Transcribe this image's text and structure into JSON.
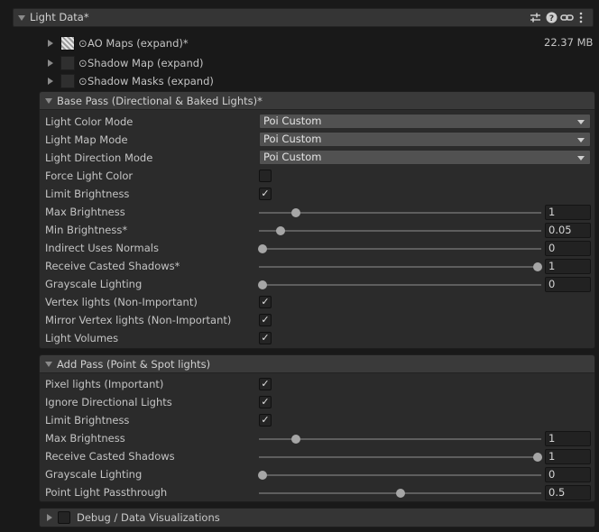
{
  "header": {
    "title": "Light Data*"
  },
  "textures": [
    {
      "label": "AO Maps (expand)*",
      "size": "22.37 MB",
      "has_preview": true
    },
    {
      "label": "Shadow Map (expand)",
      "size": "",
      "has_preview": false
    },
    {
      "label": "Shadow Masks (expand)",
      "size": "",
      "has_preview": false
    }
  ],
  "base_pass": {
    "title": "Base Pass (Directional & Baked Lights)*",
    "light_color_mode": {
      "label": "Light Color Mode",
      "value": "Poi Custom"
    },
    "light_map_mode": {
      "label": "Light Map Mode",
      "value": "Poi Custom"
    },
    "light_direction_mode": {
      "label": "Light Direction Mode",
      "value": "Poi Custom"
    },
    "force_light_color": {
      "label": "Force Light Color",
      "checked": false,
      "mark": ""
    },
    "limit_brightness": {
      "label": "Limit Brightness",
      "checked": true,
      "mark": "✓"
    },
    "max_brightness": {
      "label": "Max Brightness",
      "value": "1",
      "fraction": 0.12
    },
    "min_brightness": {
      "label": "Min Brightness*",
      "value": "0.05",
      "fraction": 0.065
    },
    "indirect_uses_normals": {
      "label": "Indirect Uses Normals",
      "value": "0",
      "fraction": 0
    },
    "receive_casted_shadows": {
      "label": "Receive Casted Shadows*",
      "value": "1",
      "fraction": 1
    },
    "grayscale_lighting": {
      "label": "Grayscale Lighting",
      "value": "0",
      "fraction": 0
    },
    "vertex_lights": {
      "label": "Vertex lights (Non-Important)",
      "checked": true,
      "mark": "✓"
    },
    "mirror_vertex_lights": {
      "label": "Mirror Vertex lights (Non-Important)",
      "checked": true,
      "mark": "✓"
    },
    "light_volumes": {
      "label": "Light Volumes",
      "checked": true,
      "mark": "✓"
    }
  },
  "add_pass": {
    "title": "Add Pass (Point & Spot lights)",
    "pixel_lights": {
      "label": "Pixel lights (Important)",
      "checked": true,
      "mark": "✓"
    },
    "ignore_directional": {
      "label": "Ignore Directional Lights",
      "checked": true,
      "mark": "✓"
    },
    "limit_brightness": {
      "label": "Limit Brightness",
      "checked": true,
      "mark": "✓"
    },
    "max_brightness": {
      "label": "Max Brightness",
      "value": "1",
      "fraction": 0.12
    },
    "receive_casted_shadows": {
      "label": "Receive Casted Shadows",
      "value": "1",
      "fraction": 1
    },
    "grayscale_lighting": {
      "label": "Grayscale Lighting",
      "value": "0",
      "fraction": 0
    },
    "point_light_passthrough": {
      "label": "Point Light Passthrough",
      "value": "0.5",
      "fraction": 0.5
    }
  },
  "debug": {
    "title": "Debug / Data Visualizations",
    "checked": false
  }
}
